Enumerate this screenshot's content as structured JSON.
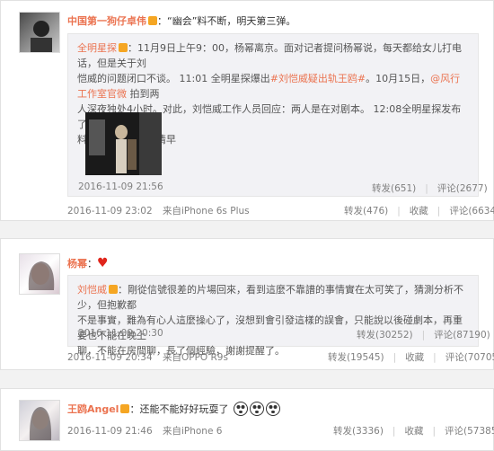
{
  "posts": [
    {
      "username": "中国第一狗仔卓伟",
      "text": "：“幽会”料不断，明天第三弹。",
      "repost": {
        "username": "全明星探",
        "line1": "：11月9日上午9：00，杨幂离京。面对记者提问杨幂说，每天都给女儿打电话，但是关于刘",
        "line2": "恺威的问题闭口不谈。 11:01 全明星探爆出",
        "hashtag": "#刘恺威疑出轨王鸥#",
        "line2b": "。10月15日，",
        "mention": "@风行工作室官微",
        "line2c": " 拍到两",
        "line3": "人深夜独处4小时。对此，刘恺威工作人员回应：两人是在对剧本。 12:08全明星探发布了一条用户爆",
        "line4": "料，刘恺威王鸥恋情早",
        "time": "2016-11-09 21:56",
        "forward": "转发(651)",
        "comment": "评论(2677)"
      },
      "time": "2016-11-09 23:02",
      "source": "来自iPhone 6s Plus",
      "forward": "转发(476)",
      "favorite": "收藏",
      "comment": "评论(6634)"
    },
    {
      "username": "杨幂",
      "text": "：",
      "heart": "♥",
      "repost": {
        "username": "刘恺威",
        "line1": "：剛從信號很差的片場回來，看到這麼不靠譜的事情實在太可笑了，猜測分析不少，但抱歉都",
        "line2": "不是事實，難為有心人這麼操心了，沒想到會引發這樣的誤會，只能說以後碰劇本，再重要也不能在晚上",
        "line3": "聊，不能在房間聊，長了個經驗，謝謝提醒了。",
        "time": "2016-11-09 20:30",
        "forward": "转发(30252)",
        "comment": "评论(87190)"
      },
      "time": "2016-11-09 20:34",
      "source": "来自OPPO R9s",
      "forward": "转发(19545)",
      "favorite": "收藏",
      "comment": "评论(70705)"
    },
    {
      "username": "王鸥Angel",
      "text": "：还能不能好好玩耍了",
      "time": "2016-11-09 21:46",
      "source": "来自iPhone 6",
      "forward": "转发(3336)",
      "favorite": "收藏",
      "comment": "评论(57385)"
    }
  ]
}
